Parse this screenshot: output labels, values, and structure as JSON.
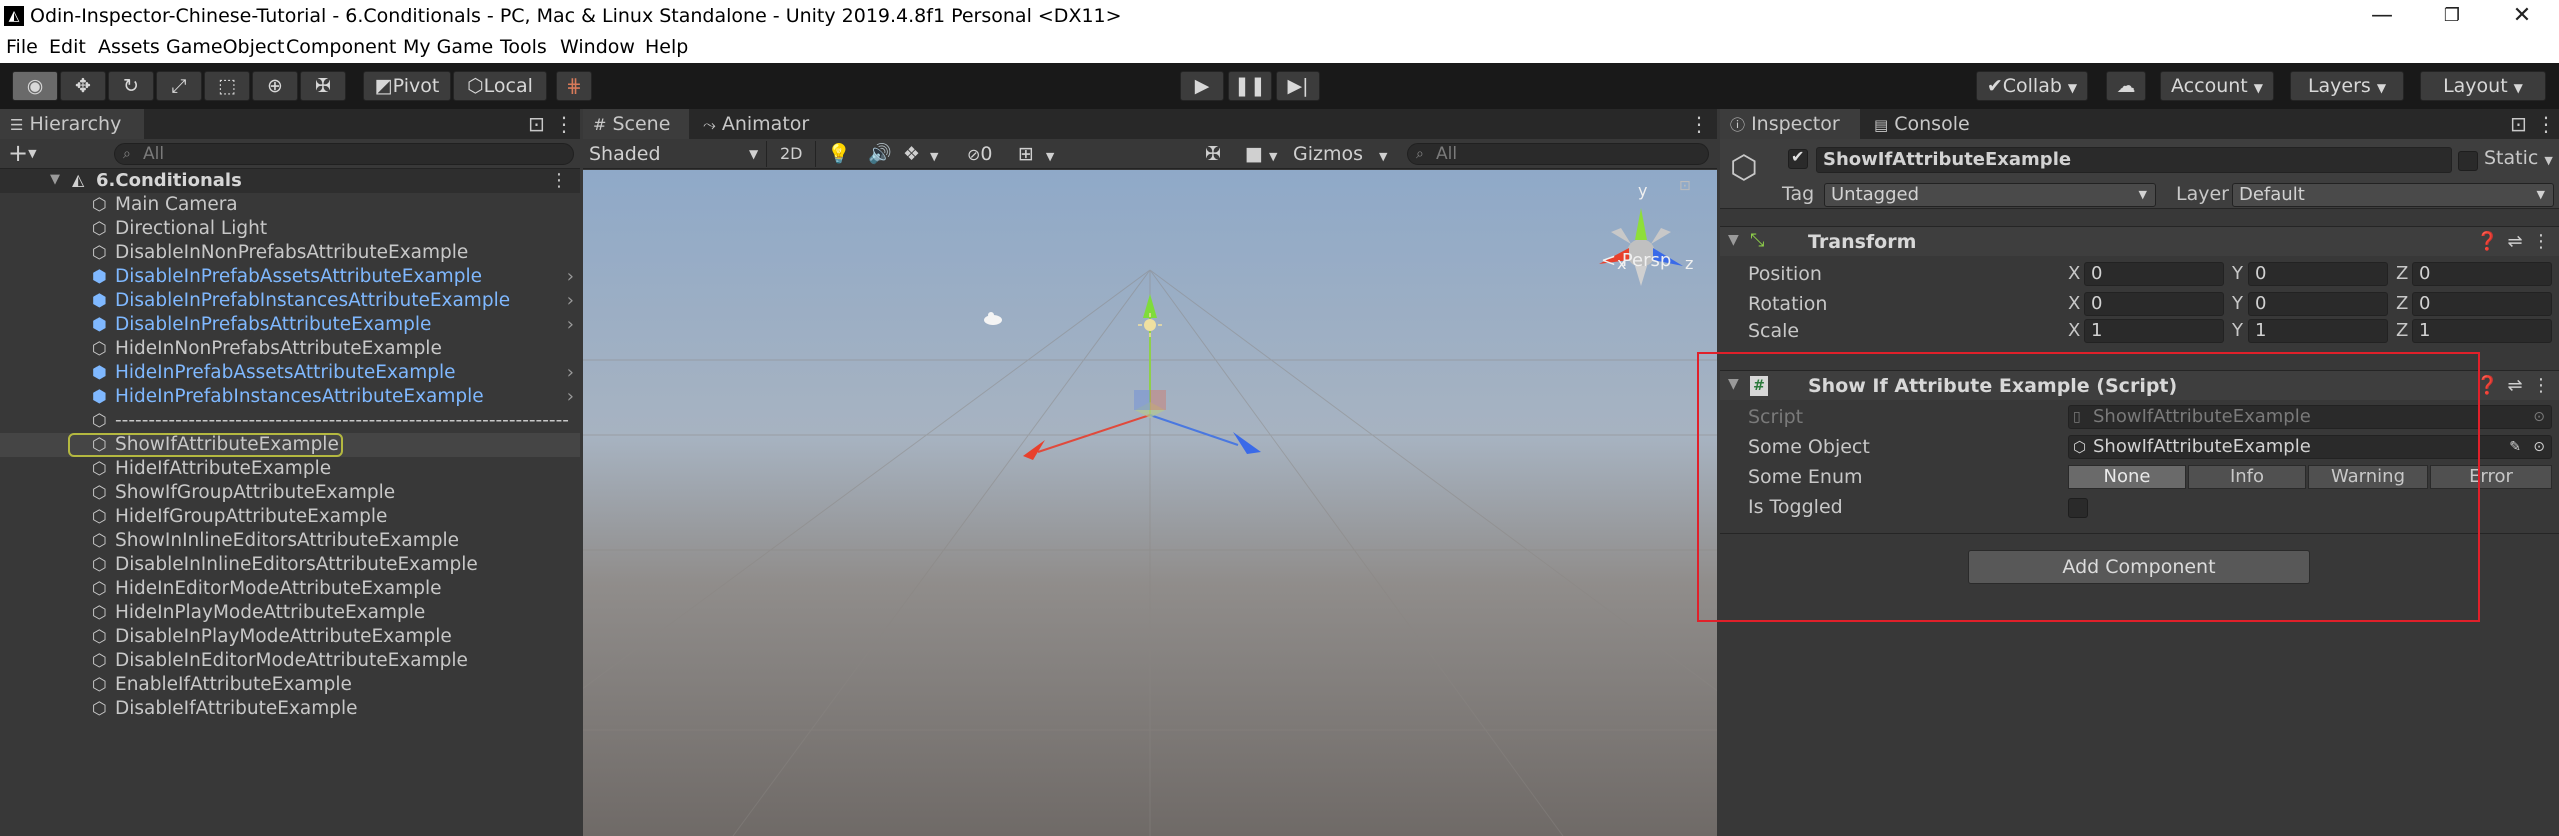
{
  "window": {
    "title": "Odin-Inspector-Chinese-Tutorial - 6.Conditionals - PC, Mac & Linux Standalone - Unity 2019.4.8f1 Personal <DX11>",
    "controls": {
      "minimize": "—",
      "maximize": "❐",
      "close": "✕"
    }
  },
  "menu": [
    "File",
    "Edit",
    "Assets",
    "GameObject",
    "Component",
    "My Game",
    "Tools",
    "Window",
    "Help"
  ],
  "toolbar": {
    "pivot_label": "Pivot",
    "local_label": "Local",
    "collab_label": "Collab",
    "account_label": "Account",
    "layers_label": "Layers",
    "layout_label": "Layout"
  },
  "hierarchy": {
    "tab_label": "Hierarchy",
    "search_placeholder": "All",
    "scene_name": "6.Conditionals",
    "items": [
      {
        "label": "Main Camera",
        "prefab": false,
        "expandable": false
      },
      {
        "label": "Directional Light",
        "prefab": false,
        "expandable": false
      },
      {
        "label": "DisableInNonPrefabsAttributeExample",
        "prefab": false,
        "expandable": false
      },
      {
        "label": "DisableInPrefabAssetsAttributeExample",
        "prefab": true,
        "expandable": true
      },
      {
        "label": "DisableInPrefabInstancesAttributeExample",
        "prefab": true,
        "expandable": true
      },
      {
        "label": "DisableInPrefabsAttributeExample",
        "prefab": true,
        "expandable": true
      },
      {
        "label": "HideInNonPrefabsAttributeExample",
        "prefab": false,
        "expandable": false
      },
      {
        "label": "HideInPrefabAssetsAttributeExample",
        "prefab": true,
        "expandable": true
      },
      {
        "label": "HideInPrefabInstancesAttributeExample",
        "prefab": true,
        "expandable": true
      },
      {
        "label": "--------------------------------------------------------------------",
        "prefab": false,
        "expandable": false
      },
      {
        "label": "ShowIfAttributeExample",
        "prefab": false,
        "expandable": false,
        "selected": true
      },
      {
        "label": "HideIfAttributeExample",
        "prefab": false,
        "expandable": false
      },
      {
        "label": "ShowIfGroupAttributeExample",
        "prefab": false,
        "expandable": false
      },
      {
        "label": "HideIfGroupAttributeExample",
        "prefab": false,
        "expandable": false
      },
      {
        "label": "ShowInInlineEditorsAttributeExample",
        "prefab": false,
        "expandable": false
      },
      {
        "label": "DisableInInlineEditorsAttributeExample",
        "prefab": false,
        "expandable": false
      },
      {
        "label": "HideInEditorModeAttributeExample",
        "prefab": false,
        "expandable": false
      },
      {
        "label": "HideInPlayModeAttributeExample",
        "prefab": false,
        "expandable": false
      },
      {
        "label": "DisableInPlayModeAttributeExample",
        "prefab": false,
        "expandable": false
      },
      {
        "label": "DisableInEditorModeAttributeExample",
        "prefab": false,
        "expandable": false
      },
      {
        "label": "EnableIfAttributeExample",
        "prefab": false,
        "expandable": false
      },
      {
        "label": "DisableIfAttributeExample",
        "prefab": false,
        "expandable": false
      }
    ]
  },
  "scene": {
    "tab_scene": "Scene",
    "tab_animator": "Animator",
    "shading_mode": "Shaded",
    "mode_2d": "2D",
    "hidden_count": "0",
    "gizmos_label": "Gizmos",
    "search_placeholder": "All",
    "persp_label": "Persp",
    "axis_x": "x",
    "axis_y": "y",
    "axis_z": "z"
  },
  "inspector": {
    "tab_inspector": "Inspector",
    "tab_console": "Console",
    "object_name": "ShowIfAttributeExample",
    "static_label": "Static",
    "tag_label": "Tag",
    "tag_value": "Untagged",
    "layer_label": "Layer",
    "layer_value": "Default",
    "transform": {
      "title": "Transform",
      "position_label": "Position",
      "rotation_label": "Rotation",
      "scale_label": "Scale",
      "position": {
        "x": "0",
        "y": "0",
        "z": "0"
      },
      "rotation": {
        "x": "0",
        "y": "0",
        "z": "0"
      },
      "scale": {
        "x": "1",
        "y": "1",
        "z": "1"
      }
    },
    "script_component": {
      "title": "Show If Attribute Example (Script)",
      "script_label": "Script",
      "script_value": "ShowIfAttributeExample",
      "some_object_label": "Some Object",
      "some_object_value": "ShowIfAttributeExample",
      "some_enum_label": "Some Enum",
      "enum_options": [
        "None",
        "Info",
        "Warning",
        "Error"
      ],
      "enum_selected": "None",
      "is_toggled_label": "Is Toggled"
    },
    "add_component_label": "Add Component"
  },
  "colors": {
    "highlight_box": "#e0202a",
    "selection_outline": "#b4b840",
    "prefab_text": "#7fb8ff"
  }
}
